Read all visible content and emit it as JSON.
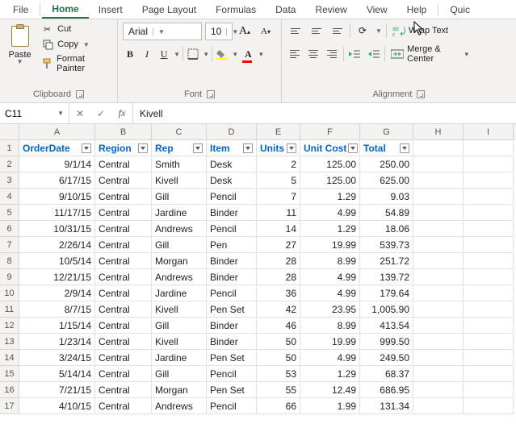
{
  "menu": {
    "file": "File",
    "home": "Home",
    "insert": "Insert",
    "page_layout": "Page Layout",
    "formulas": "Formulas",
    "data": "Data",
    "review": "Review",
    "view": "View",
    "help": "Help",
    "quick": "Quic"
  },
  "clipboard": {
    "paste": "Paste",
    "cut": "Cut",
    "copy": "Copy",
    "format_painter": "Format Painter",
    "group": "Clipboard"
  },
  "font": {
    "name": "Arial",
    "size": "10",
    "group": "Font",
    "bold": "B",
    "italic": "I",
    "underline": "U"
  },
  "alignment": {
    "wrap": "Wrap Text",
    "merge": "Merge & Center",
    "group": "Alignment"
  },
  "formula_bar": {
    "cell_ref": "C11",
    "value": "Kivell",
    "cancel": "✕",
    "enter": "✓",
    "fx": "fx"
  },
  "columns": [
    "A",
    "B",
    "C",
    "D",
    "E",
    "F",
    "G",
    "H",
    "I"
  ],
  "headers": {
    "A": "OrderDate",
    "B": "Region",
    "C": "Rep",
    "D": "Item",
    "E": "Units",
    "F": "Unit Cost",
    "G": "Total"
  },
  "rows": [
    {
      "n": 1
    },
    {
      "n": 2,
      "A": "9/1/14",
      "B": "Central",
      "C": "Smith",
      "D": "Desk",
      "E": "2",
      "F": "125.00",
      "G": "250.00"
    },
    {
      "n": 3,
      "A": "6/17/15",
      "B": "Central",
      "C": "Kivell",
      "D": "Desk",
      "E": "5",
      "F": "125.00",
      "G": "625.00"
    },
    {
      "n": 4,
      "A": "9/10/15",
      "B": "Central",
      "C": "Gill",
      "D": "Pencil",
      "E": "7",
      "F": "1.29",
      "G": "9.03"
    },
    {
      "n": 5,
      "A": "11/17/15",
      "B": "Central",
      "C": "Jardine",
      "D": "Binder",
      "E": "11",
      "F": "4.99",
      "G": "54.89"
    },
    {
      "n": 6,
      "A": "10/31/15",
      "B": "Central",
      "C": "Andrews",
      "D": "Pencil",
      "E": "14",
      "F": "1.29",
      "G": "18.06"
    },
    {
      "n": 7,
      "A": "2/26/14",
      "B": "Central",
      "C": "Gill",
      "D": "Pen",
      "E": "27",
      "F": "19.99",
      "G": "539.73"
    },
    {
      "n": 8,
      "A": "10/5/14",
      "B": "Central",
      "C": "Morgan",
      "D": "Binder",
      "E": "28",
      "F": "8.99",
      "G": "251.72"
    },
    {
      "n": 9,
      "A": "12/21/15",
      "B": "Central",
      "C": "Andrews",
      "D": "Binder",
      "E": "28",
      "F": "4.99",
      "G": "139.72"
    },
    {
      "n": 10,
      "A": "2/9/14",
      "B": "Central",
      "C": "Jardine",
      "D": "Pencil",
      "E": "36",
      "F": "4.99",
      "G": "179.64"
    },
    {
      "n": 11,
      "A": "8/7/15",
      "B": "Central",
      "C": "Kivell",
      "D": "Pen Set",
      "E": "42",
      "F": "23.95",
      "G": "1,005.90"
    },
    {
      "n": 12,
      "A": "1/15/14",
      "B": "Central",
      "C": "Gill",
      "D": "Binder",
      "E": "46",
      "F": "8.99",
      "G": "413.54"
    },
    {
      "n": 13,
      "A": "1/23/14",
      "B": "Central",
      "C": "Kivell",
      "D": "Binder",
      "E": "50",
      "F": "19.99",
      "G": "999.50"
    },
    {
      "n": 14,
      "A": "3/24/15",
      "B": "Central",
      "C": "Jardine",
      "D": "Pen Set",
      "E": "50",
      "F": "4.99",
      "G": "249.50"
    },
    {
      "n": 15,
      "A": "5/14/14",
      "B": "Central",
      "C": "Gill",
      "D": "Pencil",
      "E": "53",
      "F": "1.29",
      "G": "68.37"
    },
    {
      "n": 16,
      "A": "7/21/15",
      "B": "Central",
      "C": "Morgan",
      "D": "Pen Set",
      "E": "55",
      "F": "12.49",
      "G": "686.95"
    },
    {
      "n": 17,
      "A": "4/10/15",
      "B": "Central",
      "C": "Andrews",
      "D": "Pencil",
      "E": "66",
      "F": "1.99",
      "G": "131.34"
    }
  ]
}
